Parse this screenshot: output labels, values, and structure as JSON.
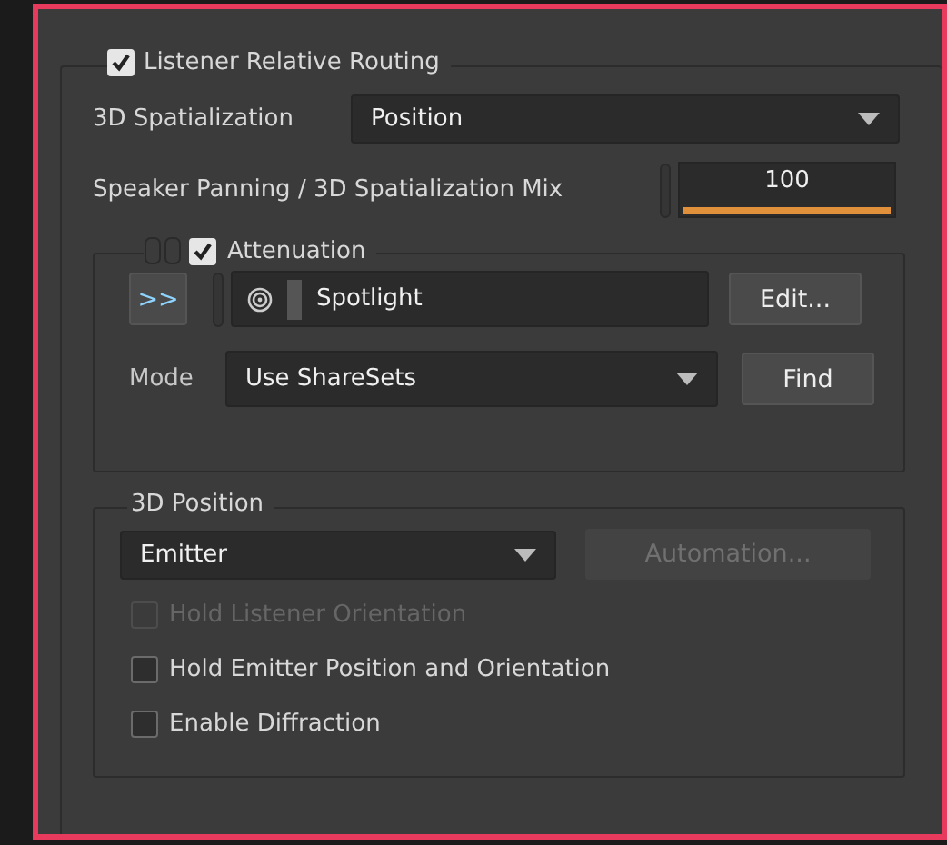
{
  "listener_relative_routing": {
    "label": "Listener Relative Routing",
    "checked": true
  },
  "spatialization": {
    "label": "3D Spatialization",
    "value": "Position"
  },
  "mix": {
    "label": "Speaker Panning / 3D Spatialization Mix",
    "value": "100",
    "level": 1.0
  },
  "attenuation": {
    "label": "Attenuation",
    "checked": true,
    "expand_button": ">>",
    "shareset": "Spotlight",
    "edit_button": "Edit...",
    "mode_label": "Mode",
    "mode": "Use ShareSets",
    "find_button": "Find"
  },
  "position": {
    "title": "3D Position",
    "source": "Emitter",
    "automation_button": {
      "label": "Automation...",
      "disabled": true
    },
    "options": [
      {
        "label": "Hold Listener Orientation",
        "checked": false,
        "disabled": true
      },
      {
        "label": "Hold Emitter Position and Orientation",
        "checked": false,
        "disabled": false
      },
      {
        "label": "Enable Diffraction",
        "checked": false,
        "disabled": false
      }
    ]
  }
}
